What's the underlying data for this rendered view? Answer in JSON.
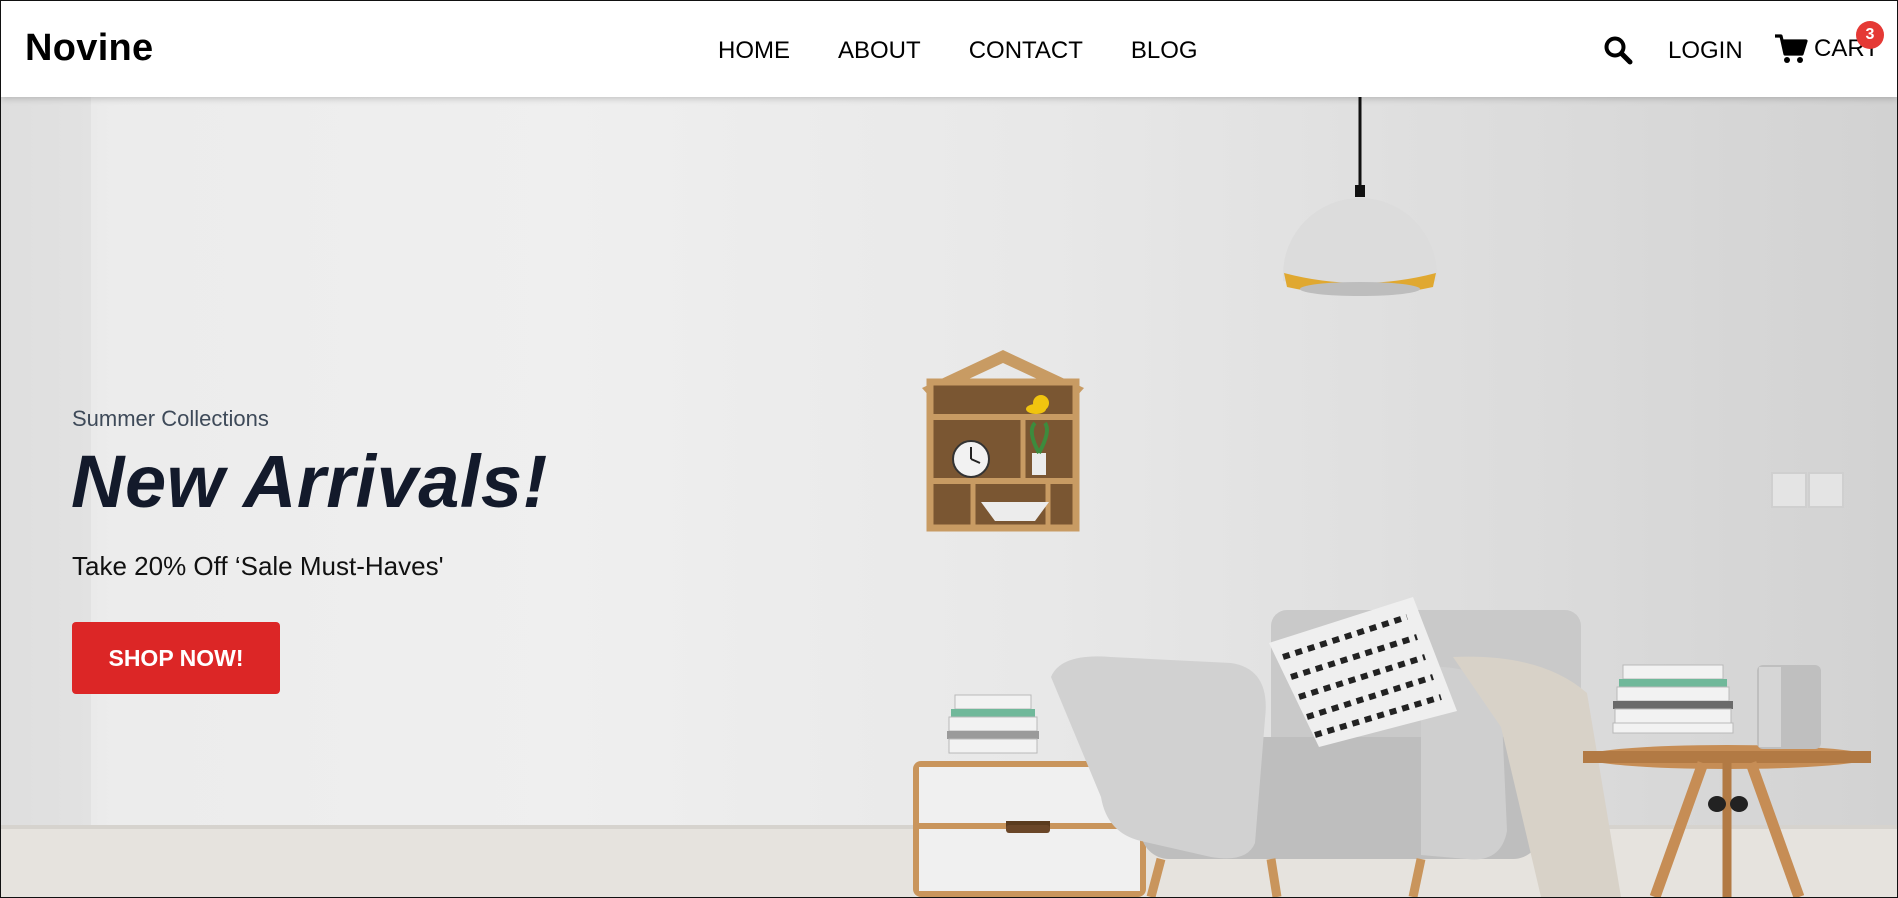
{
  "brand": {
    "name": "Novine"
  },
  "nav": {
    "items": [
      {
        "label": "HOME"
      },
      {
        "label": "ABOUT"
      },
      {
        "label": "CONTACT"
      },
      {
        "label": "BLOG"
      }
    ]
  },
  "header_actions": {
    "search_icon": "search-icon",
    "login_label": "LOGIN",
    "cart_label": "CART",
    "cart_icon": "cart-icon",
    "cart_count": "3"
  },
  "hero": {
    "kicker": "Summer Collections",
    "title": "New Arrivals!",
    "subtitle": "Take 20% Off ‘Sale Must-Haves'",
    "cta_label": "SHOP NOW!"
  },
  "colors": {
    "cta": "#dc2626",
    "badge": "#e53935",
    "title": "#131a2b",
    "lamp_trim": "#e0a830"
  }
}
